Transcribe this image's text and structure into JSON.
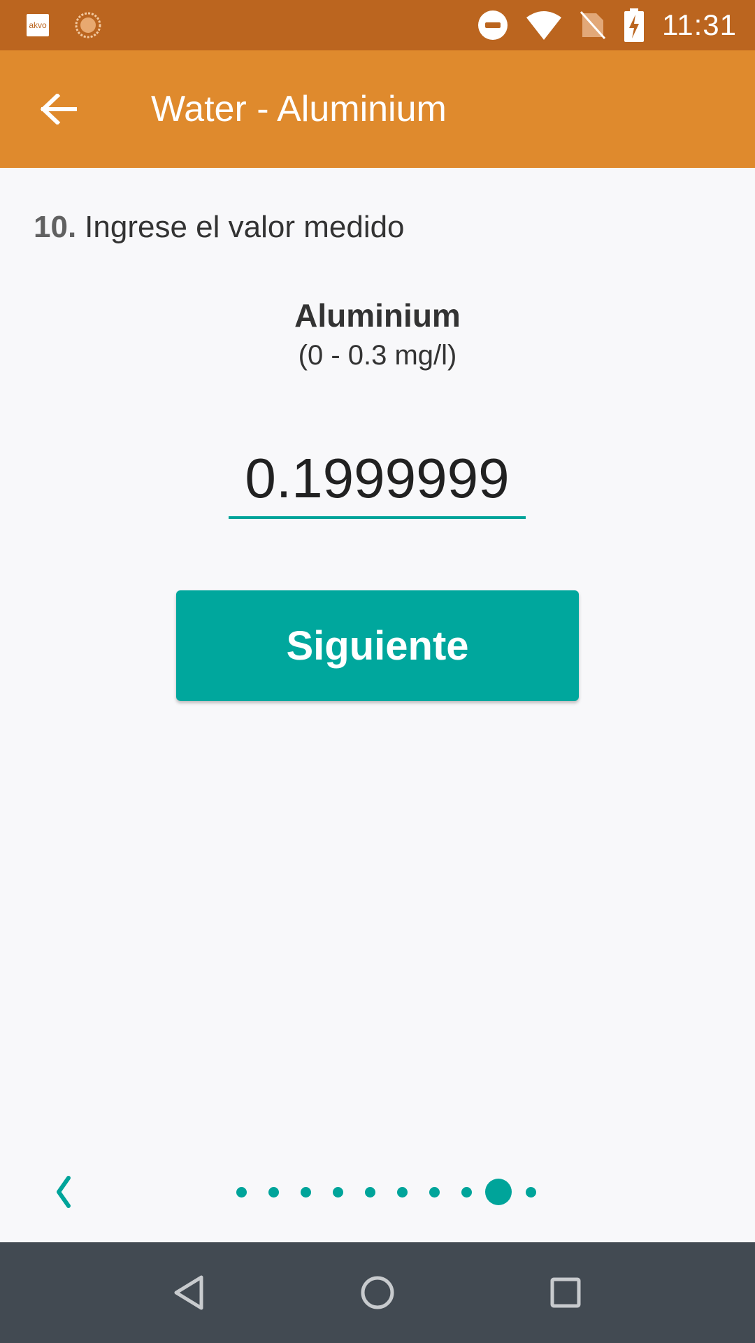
{
  "status_bar": {
    "app_icon_text": "akvo",
    "time": "11:31",
    "icons": [
      "akvo-app-icon",
      "sun-icon",
      "do-not-disturb-icon",
      "wifi-icon",
      "no-sim-icon",
      "battery-charging-icon"
    ]
  },
  "app_bar": {
    "back_icon": "arrow-back-icon",
    "title": "Water - Aluminium"
  },
  "question": {
    "number": "10.",
    "text": "Ingrese el valor medido"
  },
  "parameter": {
    "name": "Aluminium",
    "range": "(0 - 0.3 mg/l)"
  },
  "input": {
    "value": "0.1999999"
  },
  "next_button": {
    "label": "Siguiente"
  },
  "pager": {
    "prev_icon": "chevron-left-icon",
    "total_pages": 10,
    "current_page": 9
  },
  "nav_bar": {
    "icons": [
      "back-triangle-icon",
      "home-circle-icon",
      "recents-square-icon"
    ]
  },
  "colors": {
    "status_bar": "#bb651f",
    "app_bar": "#df8a2d",
    "accent": "#00a79d",
    "nav_bar": "#424a52",
    "background": "#f8f8fa"
  }
}
